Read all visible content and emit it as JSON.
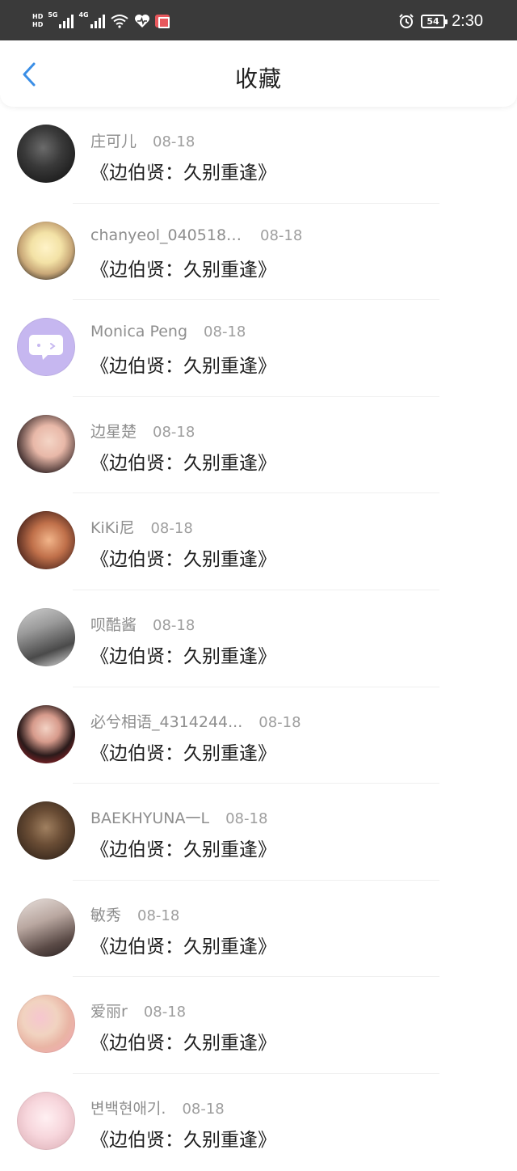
{
  "status_bar": {
    "time": "2:30",
    "battery": "54",
    "network_5g": "5G",
    "network_4g": "4G",
    "hd1": "HD",
    "hd2": "HD",
    "icons": [
      "signal-icon",
      "wifi-icon",
      "heart-health-icon",
      "app-notification-icon",
      "alarm-icon",
      "battery-icon"
    ]
  },
  "header": {
    "title": "收藏",
    "back_icon": "chevron-left-icon",
    "accent_color": "#3a8ee6"
  },
  "items": [
    {
      "username": "庄可儿",
      "date": "08-18",
      "title": "《边伯贤：久别重逢》"
    },
    {
      "username": "chanyeol_0405180...",
      "date": "08-18",
      "title": "《边伯贤：久别重逢》"
    },
    {
      "username": "Monica Peng",
      "date": "08-18",
      "title": "《边伯贤：久别重逢》"
    },
    {
      "username": "边星楚",
      "date": "08-18",
      "title": "《边伯贤：久别重逢》"
    },
    {
      "username": "KiKi尼",
      "date": "08-18",
      "title": "《边伯贤：久别重逢》"
    },
    {
      "username": "呗酷酱",
      "date": "08-18",
      "title": "《边伯贤：久别重逢》"
    },
    {
      "username": "必兮相语_4314244...",
      "date": "08-18",
      "title": "《边伯贤：久别重逢》"
    },
    {
      "username": "BAEKHYUNA一L",
      "date": "08-18",
      "title": "《边伯贤：久别重逢》"
    },
    {
      "username": "敏秀",
      "date": "08-18",
      "title": "《边伯贤：久别重逢》"
    },
    {
      "username": "爱丽r",
      "date": "08-18",
      "title": "《边伯贤：久别重逢》"
    },
    {
      "username": "변백현애기.",
      "date": "08-18",
      "title": "《边伯贤：久别重逢》"
    }
  ]
}
